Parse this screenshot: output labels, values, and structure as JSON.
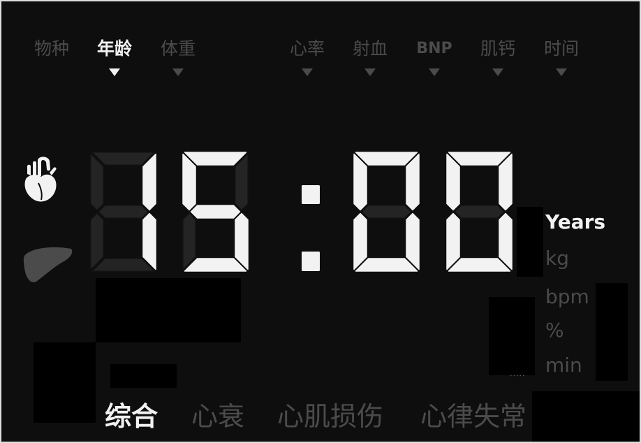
{
  "colors": {
    "background": "#0e0e0e",
    "active": "#f2f2f2",
    "inactive": "#4b4b4b",
    "segment_off": "#242424",
    "occlusion": "#000000"
  },
  "top_tabs": [
    {
      "label": "物种",
      "active": false,
      "has_dropdown": false
    },
    {
      "label": "年龄",
      "active": true,
      "has_dropdown": true
    },
    {
      "label": "体重",
      "active": false,
      "has_dropdown": true
    },
    {
      "label": "心率",
      "active": false,
      "has_dropdown": true
    },
    {
      "label": "射血",
      "active": false,
      "has_dropdown": true
    },
    {
      "label": "BNP",
      "active": false,
      "has_dropdown": true
    },
    {
      "label": "肌钙",
      "active": false,
      "has_dropdown": true
    },
    {
      "label": "时间",
      "active": false,
      "has_dropdown": true
    }
  ],
  "organs": [
    {
      "icon": "heart-icon",
      "active": true
    },
    {
      "icon": "liver-icon",
      "active": false
    }
  ],
  "display": {
    "value": "15:00"
  },
  "units": [
    {
      "label": "Years",
      "active": true
    },
    {
      "label": "kg",
      "active": false
    },
    {
      "label": "bpm",
      "active": false
    },
    {
      "label": "%",
      "active": false
    },
    {
      "label": "min",
      "active": false
    }
  ],
  "ellipsis": ".....",
  "bottom_tabs": [
    {
      "label": "综合",
      "active": true
    },
    {
      "label": "心衰",
      "active": false
    },
    {
      "label": "心肌损伤",
      "active": false
    },
    {
      "label": "心律失常",
      "active": false
    }
  ]
}
